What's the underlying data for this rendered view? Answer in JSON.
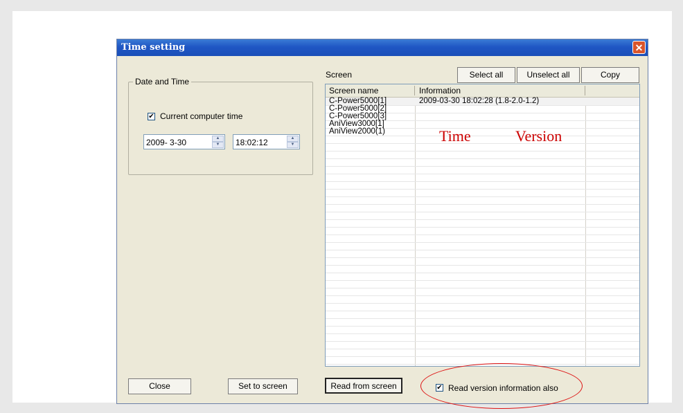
{
  "window": {
    "title": "Time setting",
    "close_glyph": "✕"
  },
  "date_time_group": {
    "label": "Date and Time",
    "current_computer_time_label": "Current computer time",
    "current_computer_time_checked": true,
    "date_value": "2009- 3-30",
    "time_value": "18:02:12"
  },
  "screen_panel": {
    "label": "Screen",
    "select_all": "Select all",
    "unselect_all": "Unselect all",
    "copy": "Copy",
    "columns": [
      "Screen name",
      "Information"
    ],
    "rows": [
      {
        "name": "C-Power5000[1]",
        "info": "2009-03-30 18:02:28 (1.8-2.0-1.2)"
      },
      {
        "name": "C-Power5000[2]",
        "info": ""
      },
      {
        "name": "C-Power5000[3]",
        "info": ""
      },
      {
        "name": "AniView3000[1]",
        "info": ""
      },
      {
        "name": "AniView2000(1)",
        "info": ""
      }
    ]
  },
  "annotations": {
    "time": "Time",
    "version": "Version",
    "color": "#cc0000"
  },
  "bottom": {
    "close": "Close",
    "set_to_screen": "Set to screen",
    "read_from_screen": "Read from screen",
    "read_version_label": "Read version information also",
    "read_version_checked": true
  }
}
